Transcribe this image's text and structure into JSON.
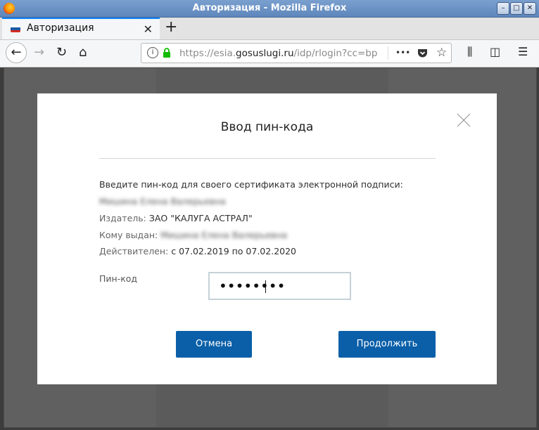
{
  "window": {
    "title": "Авторизация - Mozilla Firefox",
    "controls": {
      "minimize": "–",
      "maximize": "□",
      "close": "✕"
    }
  },
  "tab": {
    "title": "Авторизация",
    "close": "✕",
    "flag_colors": [
      "#ffffff",
      "#1c57a5",
      "#d52b1e"
    ]
  },
  "new_tab": "+",
  "toolbar": {
    "back": "←",
    "forward": "→",
    "reload": "↻",
    "home": "⌂",
    "info": "i",
    "url_prefix": "https://esia.",
    "url_domain": "gosuslugi.ru",
    "url_path": "/idp/rlogin?cc=bp",
    "page_actions": "•••",
    "library": "⫼",
    "sidebar": "◫",
    "menu": "☰"
  },
  "modal": {
    "title": "Ввод пин-кода",
    "intro": "Введите пин-код для своего сертификата электронной подписи:",
    "cert_owner": "Мишина Елена Валерьевна",
    "issuer_label": "Издатель:",
    "issuer_value": "ЗАО \"КАЛУГА АСТРАЛ\"",
    "issued_to_label": "Кому выдан:",
    "issued_to_value": "Мишина Елена Валерьевна",
    "valid_label": "Действителен:",
    "valid_value": "с 07.02.2019 по 07.02.2020",
    "pin_label": "Пин-код",
    "pin_value": "••••••••",
    "cancel_button": "Отмена",
    "continue_button": "Продолжить"
  },
  "colors": {
    "accent": "#0a84ff",
    "button": "#0a5fa8",
    "overlay": "#5f605f",
    "lock": "#12bc00"
  }
}
